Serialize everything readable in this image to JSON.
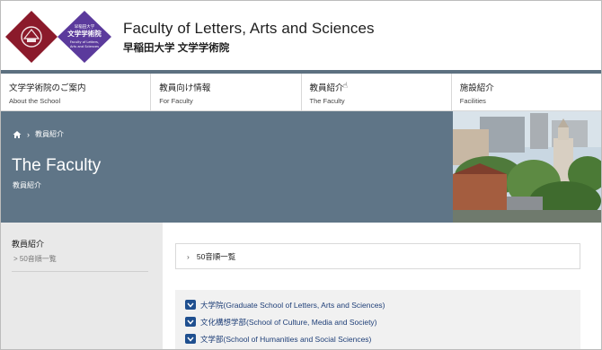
{
  "header": {
    "logo_university_text": "WASEDA",
    "logo_faculty_lines": [
      "早稲田大学",
      "文学学術院",
      "Faculty of Letters,",
      "Arts and Sciences"
    ],
    "title": "Faculty of Letters, Arts and Sciences",
    "subtitle": "早稲田大学 文学学術院"
  },
  "nav": [
    {
      "jp": "文学学術院のご案内",
      "en": "About the School"
    },
    {
      "jp": "教員向け情報",
      "en": "For Faculty"
    },
    {
      "jp": "教員紹介",
      "en": "The Faculty"
    },
    {
      "jp": "施設紹介",
      "en": "Facilities"
    }
  ],
  "hero": {
    "breadcrumb_current": "教員紹介",
    "title": "The Faculty",
    "subtitle": "教員紹介"
  },
  "sidebar": {
    "title": "教員紹介",
    "link": "> 50音順一覧"
  },
  "main": {
    "list_link": "50音順一覧",
    "accordion": [
      "大学院(Graduate School of Letters, Arts and Sciences)",
      "文化構想学部(School of Culture, Media and Society)",
      "文学部(School of Humanities and Social Sciences)"
    ]
  },
  "colors": {
    "brand_crimson": "#8b1a2b",
    "brand_purple": "#5b3a9c",
    "hero_bg": "#5f7587",
    "accent_blue": "#1f4f8f"
  }
}
